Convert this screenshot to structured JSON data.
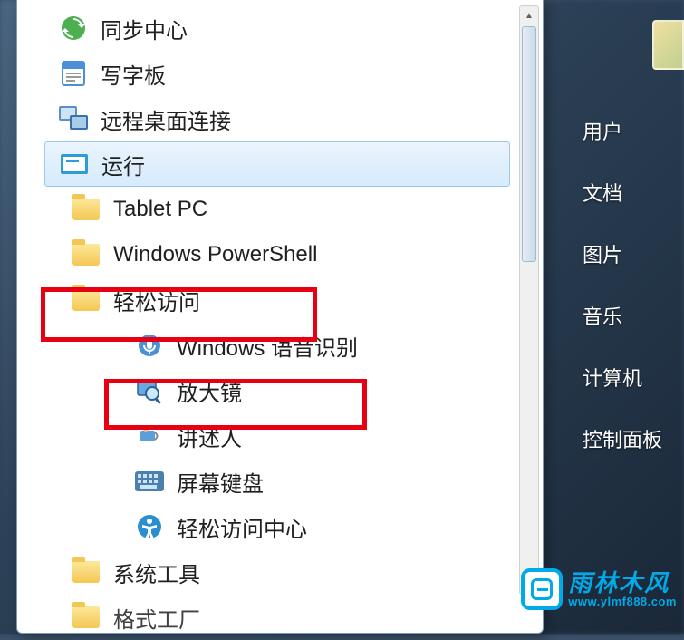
{
  "rightPanel": {
    "items": [
      {
        "label": "用户"
      },
      {
        "label": "文档"
      },
      {
        "label": "图片"
      },
      {
        "label": "音乐"
      },
      {
        "label": "计算机"
      },
      {
        "label": "控制面板"
      }
    ]
  },
  "menu": {
    "items": [
      {
        "label": "同步中心",
        "icon": "sync"
      },
      {
        "label": "写字板",
        "icon": "wordpad"
      },
      {
        "label": "远程桌面连接",
        "icon": "remote"
      },
      {
        "label": "运行",
        "icon": "run",
        "selected": true
      },
      {
        "label": "Tablet PC",
        "icon": "folder",
        "indent": 1
      },
      {
        "label": "Windows PowerShell",
        "icon": "folder",
        "indent": 1
      },
      {
        "label": "轻松访问",
        "icon": "folder",
        "indent": 1
      },
      {
        "label": "Windows 语音识别",
        "icon": "speech",
        "indent": 2
      },
      {
        "label": "放大镜",
        "icon": "magnifier",
        "indent": 2
      },
      {
        "label": "讲述人",
        "icon": "narrator",
        "indent": 2
      },
      {
        "label": "屏幕键盘",
        "icon": "keyboard",
        "indent": 2
      },
      {
        "label": "轻松访问中心",
        "icon": "ease",
        "indent": 2
      },
      {
        "label": "系统工具",
        "icon": "folder",
        "indent": 1
      },
      {
        "label": "格式工厂",
        "icon": "folder",
        "indent": 1,
        "cutoff": true
      }
    ]
  },
  "watermark": {
    "title": "雨林木风",
    "url": "www.ylmf888.com"
  }
}
